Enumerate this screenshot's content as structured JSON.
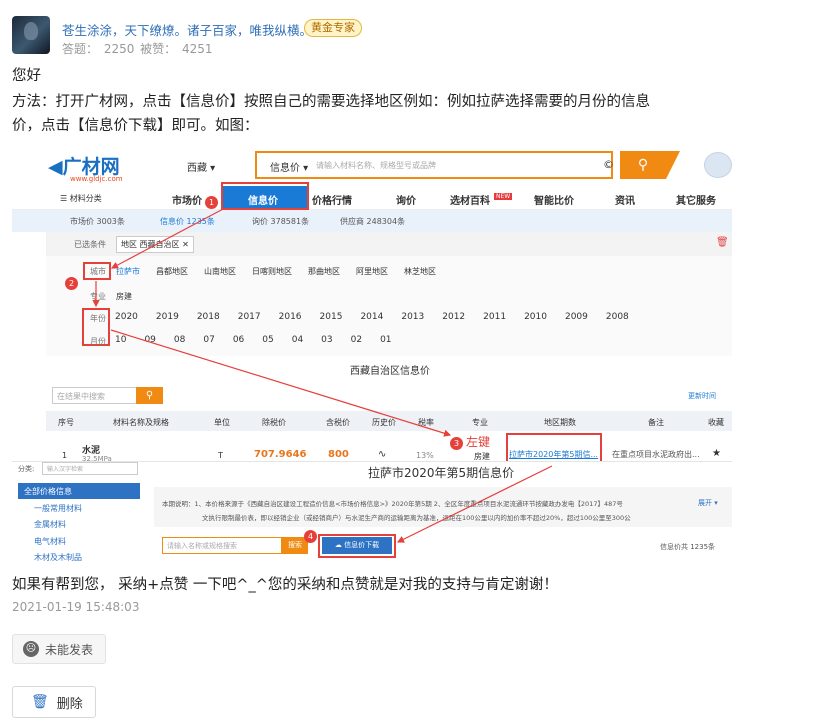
{
  "answerer": {
    "name": "苍生涂涂，天下缭燎。诸子百家，唯我纵横。",
    "badge": "黄金专家",
    "stats": "答题： 2250    被赞： 4251"
  },
  "answer": {
    "greeting": "您好",
    "line1": "方法：打开广材网，点击【信息价】按照自己的需要选择地区例如：例如拉萨选择需要的月份的信息",
    "line2": "价，点击【信息价下载】即可。如图：",
    "footer": "如果有帮到您， 采纳+点赞 一下吧^_^您的采纳和点赞就是对我的支持与肯定谢谢！",
    "date": "2021-01-19 15:48:03"
  },
  "actions": {
    "not_published": "未能发表",
    "delete": "删除"
  },
  "shot": {
    "logo": "广材网",
    "logo_url": "www.gldjc.com",
    "region": "西藏 ▾",
    "search_cat": "信息价 ▾",
    "search_ph": "请输入材料名称、规格型号或品牌",
    "search_icon": "search-icon",
    "nav": [
      "☰ 材料分类",
      "市场价",
      "信息价",
      "价格行情",
      "询价",
      "选材百科",
      "智能比价",
      "资讯",
      "其它服务"
    ],
    "new_tag": "NEW",
    "subtabs": [
      "市场价 3003条",
      "信息价 1235条",
      "询价 378581条",
      "供应商 248304条"
    ],
    "filter_label": "已选条件",
    "filter_value": "地区  西藏自治区  ✕",
    "city_label": "城市",
    "cities": [
      "拉萨市",
      "昌都地区",
      "山南地区",
      "日喀则地区",
      "那曲地区",
      "阿里地区",
      "林芝地区"
    ],
    "spec_label": "专业",
    "spec": "房建",
    "year_label": "年份",
    "years": [
      "2020",
      "2019",
      "2018",
      "2017",
      "2016",
      "2015",
      "2014",
      "2013",
      "2012",
      "2011",
      "2010",
      "2009",
      "2008"
    ],
    "month_label": "月份",
    "months": [
      "10",
      "09",
      "08",
      "07",
      "06",
      "05",
      "04",
      "03",
      "02",
      "01"
    ],
    "region_title": "西藏自治区信息价",
    "search_result_ph": "在结果中搜索",
    "update_time": "更新时间",
    "cols": [
      "序号",
      "材料名称及规格",
      "单位",
      "除税价",
      "含税价",
      "历史价",
      "税率",
      "专业",
      "地区期数",
      "备注",
      "收藏"
    ],
    "row": {
      "no": "1",
      "name": "水泥",
      "spec": "32.5MPa",
      "unit": "T",
      "pretax": "707.9646",
      "tax": "800",
      "hist": "∿",
      "rate": "13%",
      "major": "房建",
      "period": "拉萨市2020年第5期信...",
      "note": "在重点项目水泥政府出...",
      "fav": "★"
    },
    "left_click": "左键",
    "side_label": "分类:",
    "side_ph": "输入汉字检索",
    "side_all": "全部价格信息",
    "side_items": [
      "一般常用材料",
      "金属材料",
      "电气材料",
      "木材及木制品"
    ],
    "doc_title": "拉萨市2020年第5期信息价",
    "note_text": "本期说明：1、本价格来源于《西藏自治区建设工程造价信息<市场价格信息>》2020年第5期 2、全区年度重点项目水泥流通环节按藏政办发电【2017】487号",
    "note_text2": "文执行限制最价表，即以经销企业（或经销商户）与水泥生产商的运输距离为基准，运距在100公里以内的加价率不超过20%，超过100公里至300公",
    "expand": "展开 ▾",
    "name_ph": "请输入名称或规格搜索",
    "search_btn": "搜索",
    "download_btn": "信息价下载",
    "total": "信息价共 1235条",
    "steps": [
      "1",
      "2",
      "3",
      "4"
    ]
  }
}
